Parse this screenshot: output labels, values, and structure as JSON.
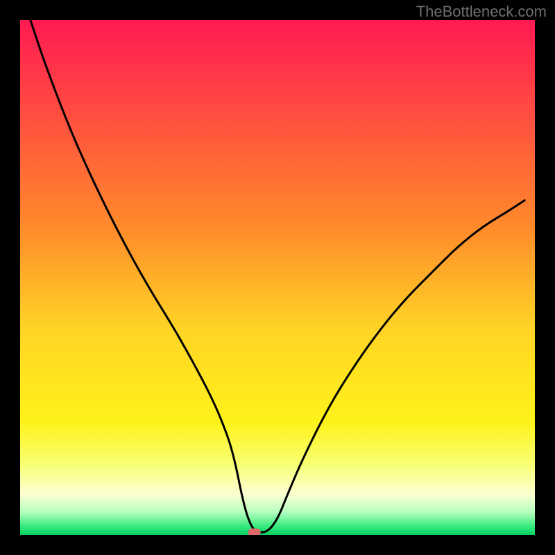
{
  "watermark": "TheBottleneck.com",
  "chart_data": {
    "type": "line",
    "title": "",
    "xlabel": "",
    "ylabel": "",
    "xlim": [
      0,
      100
    ],
    "ylim": [
      0,
      100
    ],
    "x": [
      2,
      5,
      10,
      15,
      20,
      25,
      30,
      35,
      38,
      40,
      41,
      42,
      43,
      44,
      45,
      46,
      48,
      50,
      52,
      55,
      60,
      65,
      70,
      75,
      80,
      85,
      90,
      95,
      98
    ],
    "values": [
      100,
      91,
      78,
      67,
      57,
      48,
      40,
      31,
      25,
      20,
      17,
      13,
      8,
      4,
      1.5,
      0.5,
      0.5,
      3,
      8,
      15,
      25,
      33,
      40,
      46,
      51,
      56,
      60,
      63,
      65
    ],
    "marker": {
      "x": 45.5,
      "y": 0.5
    },
    "gradient_stops": [
      {
        "pos": 0.0,
        "color": "#ff1a52"
      },
      {
        "pos": 0.4,
        "color": "#ff8a2b"
      },
      {
        "pos": 0.6,
        "color": "#ffd426"
      },
      {
        "pos": 0.78,
        "color": "#fff21a"
      },
      {
        "pos": 0.86,
        "color": "#f8ff70"
      },
      {
        "pos": 0.92,
        "color": "#fdffd0"
      },
      {
        "pos": 0.955,
        "color": "#b8ffc0"
      },
      {
        "pos": 0.985,
        "color": "#30e97a"
      },
      {
        "pos": 1.0,
        "color": "#08d060"
      }
    ]
  }
}
